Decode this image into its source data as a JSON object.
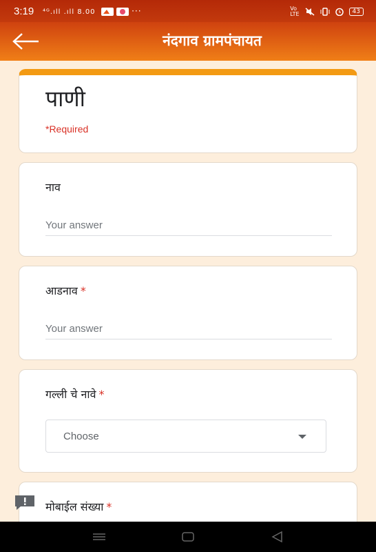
{
  "status_bar": {
    "time": "3:19",
    "left_icons_text": "⁴ᴳ.ıll .ıll 8.00",
    "battery": "43"
  },
  "app_bar": {
    "title": "नंदगाव ग्रामपंचायत",
    "back_icon": "arrow-left-icon"
  },
  "form": {
    "title": "पाणी",
    "required_note": "*Required",
    "questions": [
      {
        "label": "नाव",
        "required": false,
        "placeholder": "Your answer"
      },
      {
        "label": "आडनाव",
        "required": true,
        "placeholder": "Your answer"
      },
      {
        "label": "गल्ली चे नावे",
        "required": true,
        "selected": "Choose"
      },
      {
        "label": "मोबाईल संख्या",
        "required": true
      }
    ],
    "required_star": "*"
  },
  "colors": {
    "accent": "#f39a13",
    "appbar_top": "#cf420f",
    "appbar_bottom": "#f07f17",
    "background": "#fdeedc",
    "required": "#d93025"
  }
}
